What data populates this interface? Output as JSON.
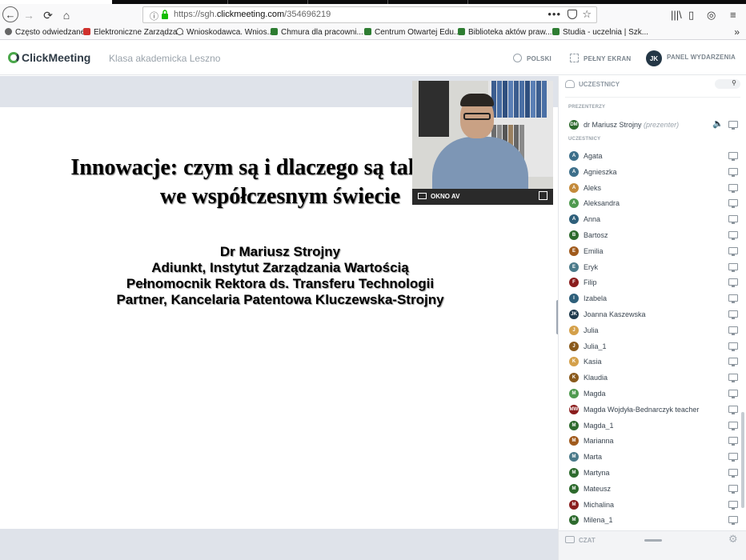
{
  "browser": {
    "url_prefix": "https://sgh.",
    "url_domain": "clickmeeting.com",
    "url_path": "/354696219",
    "page_actions": "•••",
    "bookmarks": [
      {
        "label": "Często odwiedzane",
        "color": "#555555"
      },
      {
        "label": "Elektroniczne Zarządza...",
        "color": "#d0312d"
      },
      {
        "label": "Wnioskodawca. Wnios...",
        "color": "#555555"
      },
      {
        "label": "Chmura dla pracowni...",
        "color": "#2e7d32"
      },
      {
        "label": "Centrum Otwartej Edu...",
        "color": "#2e7d32"
      },
      {
        "label": "Biblioteka aktów praw...",
        "color": "#2e7d32"
      },
      {
        "label": "Studia - uczelnia | Szk...",
        "color": "#2e7d32"
      }
    ],
    "more": "»"
  },
  "app": {
    "logo": "ClickMeeting",
    "room_name": "Klasa akademicka Leszno",
    "language": "POLSKI",
    "fullscreen": "PEŁNY EKRAN",
    "event_panel": "PANEL WYDARZENIA",
    "user_initials": "JK"
  },
  "slide": {
    "title_line1": "Innowacje: czym są i dlaczego są tak istotne",
    "title_line2": "we współczesnym świecie",
    "author_lines": [
      "Dr Mariusz Strojny",
      "Adiunkt, Instytut Zarządzania Wartością",
      "Pełnomocnik Rektora ds. Transferu Technologii",
      "Partner, Kancelaria Patentowa Kluczewska-Strojny"
    ]
  },
  "video": {
    "label": "OKNO AV"
  },
  "sidebar": {
    "title": "UCZESTNICY",
    "presenters_label": "PREZENTERZY",
    "presenter": {
      "initials": "DM",
      "name": "dr Mariusz Strojny",
      "role": "(prezenter)",
      "color": "#2d6a2d"
    },
    "participants_label": "UCZESTNICY",
    "participants": [
      {
        "initials": "A",
        "name": "Agata",
        "color": "#3d6f8a"
      },
      {
        "initials": "A",
        "name": "Agnieszka",
        "color": "#3d6f8a"
      },
      {
        "initials": "A",
        "name": "Aleks",
        "color": "#c48a3a"
      },
      {
        "initials": "A",
        "name": "Aleksandra",
        "color": "#4f9a4f"
      },
      {
        "initials": "A",
        "name": "Anna",
        "color": "#2e5f7a"
      },
      {
        "initials": "B",
        "name": "Bartosz",
        "color": "#2d6a2d"
      },
      {
        "initials": "E",
        "name": "Emilia",
        "color": "#a05a1c"
      },
      {
        "initials": "E",
        "name": "Eryk",
        "color": "#4a7a8a"
      },
      {
        "initials": "F",
        "name": "Filip",
        "color": "#8a1d1d"
      },
      {
        "initials": "I",
        "name": "Izabela",
        "color": "#2e5f7a"
      },
      {
        "initials": "JK",
        "name": "Joanna Kaszewska",
        "color": "#1f3a4d"
      },
      {
        "initials": "J",
        "name": "Julia",
        "color": "#d4a04a"
      },
      {
        "initials": "J",
        "name": "Julia_1",
        "color": "#8a5a1c"
      },
      {
        "initials": "K",
        "name": "Kasia",
        "color": "#d4a04a"
      },
      {
        "initials": "K",
        "name": "Klaudia",
        "color": "#8a5a1c"
      },
      {
        "initials": "M",
        "name": "Magda",
        "color": "#4f9a4f"
      },
      {
        "initials": "MW",
        "name": "Magda Wojdyła-Bednarczyk teacher",
        "color": "#8a1d1d"
      },
      {
        "initials": "M",
        "name": "Magda_1",
        "color": "#2d6a2d"
      },
      {
        "initials": "M",
        "name": "Marianna",
        "color": "#a05a1c"
      },
      {
        "initials": "M",
        "name": "Marta",
        "color": "#4a7a8a"
      },
      {
        "initials": "M",
        "name": "Martyna",
        "color": "#2d6a2d"
      },
      {
        "initials": "M",
        "name": "Mateusz",
        "color": "#2d6a2d"
      },
      {
        "initials": "M",
        "name": "Michalina",
        "color": "#8a1d1d"
      },
      {
        "initials": "M",
        "name": "Milena_1",
        "color": "#2d6a2d"
      }
    ],
    "chat_label": "CZAT"
  }
}
